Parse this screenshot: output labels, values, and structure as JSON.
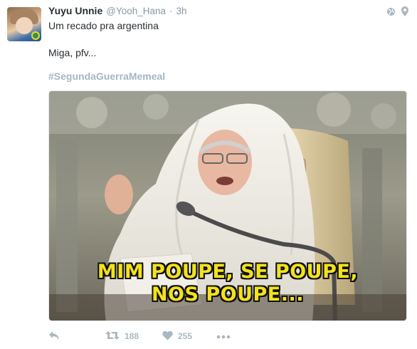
{
  "tweet": {
    "author_name": "Yuyu Unnie",
    "author_handle": "@Yooh_Hana",
    "separator": "·",
    "time": "3h",
    "text_line_1": "Um recado pra argentina",
    "text_line_2": "Miga, pfv...",
    "hashtag": "#SegundaGuerraMemeal",
    "media": {
      "caption_line_1": "MIM POUPE, SE POUPE,",
      "caption_line_2": "NOS POUPE..."
    },
    "actions": {
      "reply_icon": "reply-icon",
      "retweet_icon": "retweet-icon",
      "retweet_count": "188",
      "like_icon": "heart-icon",
      "like_count": "255",
      "more_icon": "more-icon"
    },
    "top_icons": [
      "globe-icon",
      "location-pin-icon"
    ]
  },
  "colors": {
    "text": "#292f33",
    "muted": "#8899a6",
    "hashtag": "#a3b7c7",
    "action": "#aab8c2",
    "caption": "#f3e21c"
  }
}
